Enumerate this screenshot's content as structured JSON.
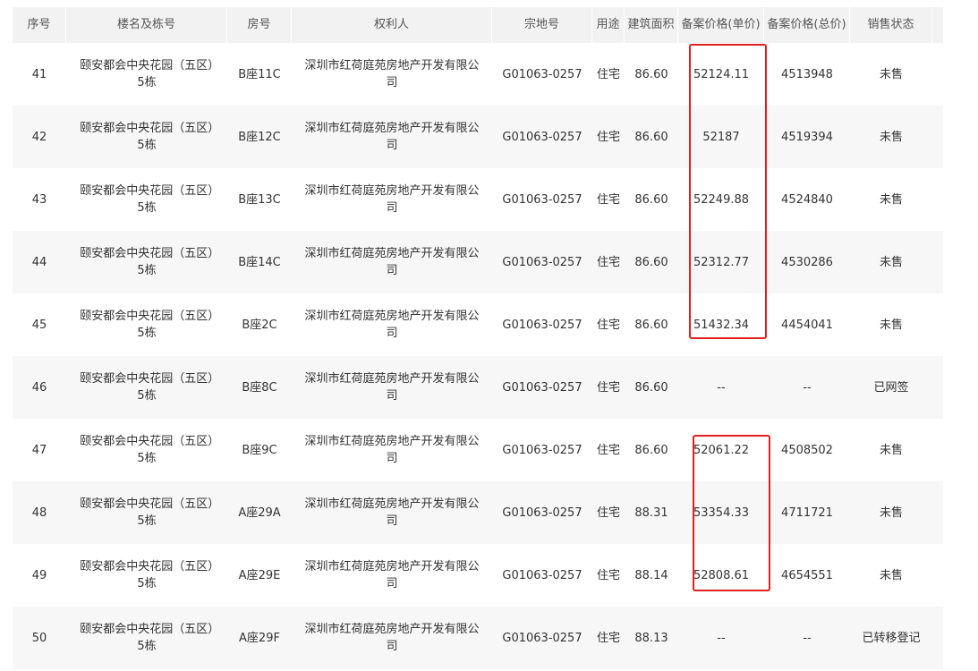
{
  "headers": [
    "序号",
    "楼名及栋号",
    "房号",
    "权利人",
    "宗地号",
    "用途",
    "建筑面积",
    "备案价格(单价)",
    "备案价格(总价)",
    "销售状态"
  ],
  "rows": [
    {
      "no": "41",
      "building": "颐安都会中央花园（五区）5栋",
      "room": "B座11C",
      "owner": "深圳市红荷庭苑房地产开发有限公司",
      "parcel": "G01063-0257",
      "use": "住宅",
      "area": "86.60",
      "unit_price": "52124.11",
      "total_price": "4513948",
      "status": "未售"
    },
    {
      "no": "42",
      "building": "颐安都会中央花园（五区）5栋",
      "room": "B座12C",
      "owner": "深圳市红荷庭苑房地产开发有限公司",
      "parcel": "G01063-0257",
      "use": "住宅",
      "area": "86.60",
      "unit_price": "52187",
      "total_price": "4519394",
      "status": "未售"
    },
    {
      "no": "43",
      "building": "颐安都会中央花园（五区）5栋",
      "room": "B座13C",
      "owner": "深圳市红荷庭苑房地产开发有限公司",
      "parcel": "G01063-0257",
      "use": "住宅",
      "area": "86.60",
      "unit_price": "52249.88",
      "total_price": "4524840",
      "status": "未售"
    },
    {
      "no": "44",
      "building": "颐安都会中央花园（五区）5栋",
      "room": "B座14C",
      "owner": "深圳市红荷庭苑房地产开发有限公司",
      "parcel": "G01063-0257",
      "use": "住宅",
      "area": "86.60",
      "unit_price": "52312.77",
      "total_price": "4530286",
      "status": "未售"
    },
    {
      "no": "45",
      "building": "颐安都会中央花园（五区）5栋",
      "room": "B座2C",
      "owner": "深圳市红荷庭苑房地产开发有限公司",
      "parcel": "G01063-0257",
      "use": "住宅",
      "area": "86.60",
      "unit_price": "51432.34",
      "total_price": "4454041",
      "status": "未售"
    },
    {
      "no": "46",
      "building": "颐安都会中央花园（五区）5栋",
      "room": "B座8C",
      "owner": "深圳市红荷庭苑房地产开发有限公司",
      "parcel": "G01063-0257",
      "use": "住宅",
      "area": "86.60",
      "unit_price": "--",
      "total_price": "--",
      "status": "已网签"
    },
    {
      "no": "47",
      "building": "颐安都会中央花园（五区）5栋",
      "room": "B座9C",
      "owner": "深圳市红荷庭苑房地产开发有限公司",
      "parcel": "G01063-0257",
      "use": "住宅",
      "area": "86.60",
      "unit_price": "52061.22",
      "total_price": "4508502",
      "status": "未售"
    },
    {
      "no": "48",
      "building": "颐安都会中央花园（五区）5栋",
      "room": "A座29A",
      "owner": "深圳市红荷庭苑房地产开发有限公司",
      "parcel": "G01063-0257",
      "use": "住宅",
      "area": "88.31",
      "unit_price": "53354.33",
      "total_price": "4711721",
      "status": "未售"
    },
    {
      "no": "49",
      "building": "颐安都会中央花园（五区）5栋",
      "room": "A座29E",
      "owner": "深圳市红荷庭苑房地产开发有限公司",
      "parcel": "G01063-0257",
      "use": "住宅",
      "area": "88.14",
      "unit_price": "52808.61",
      "total_price": "4654551",
      "status": "未售"
    },
    {
      "no": "50",
      "building": "颐安都会中央花园（五区）5栋",
      "room": "A座29F",
      "owner": "深圳市红荷庭苑房地产开发有限公司",
      "parcel": "G01063-0257",
      "use": "住宅",
      "area": "88.13",
      "unit_price": "--",
      "total_price": "--",
      "status": "已转移登记"
    }
  ],
  "highlight_color": "#e02020"
}
